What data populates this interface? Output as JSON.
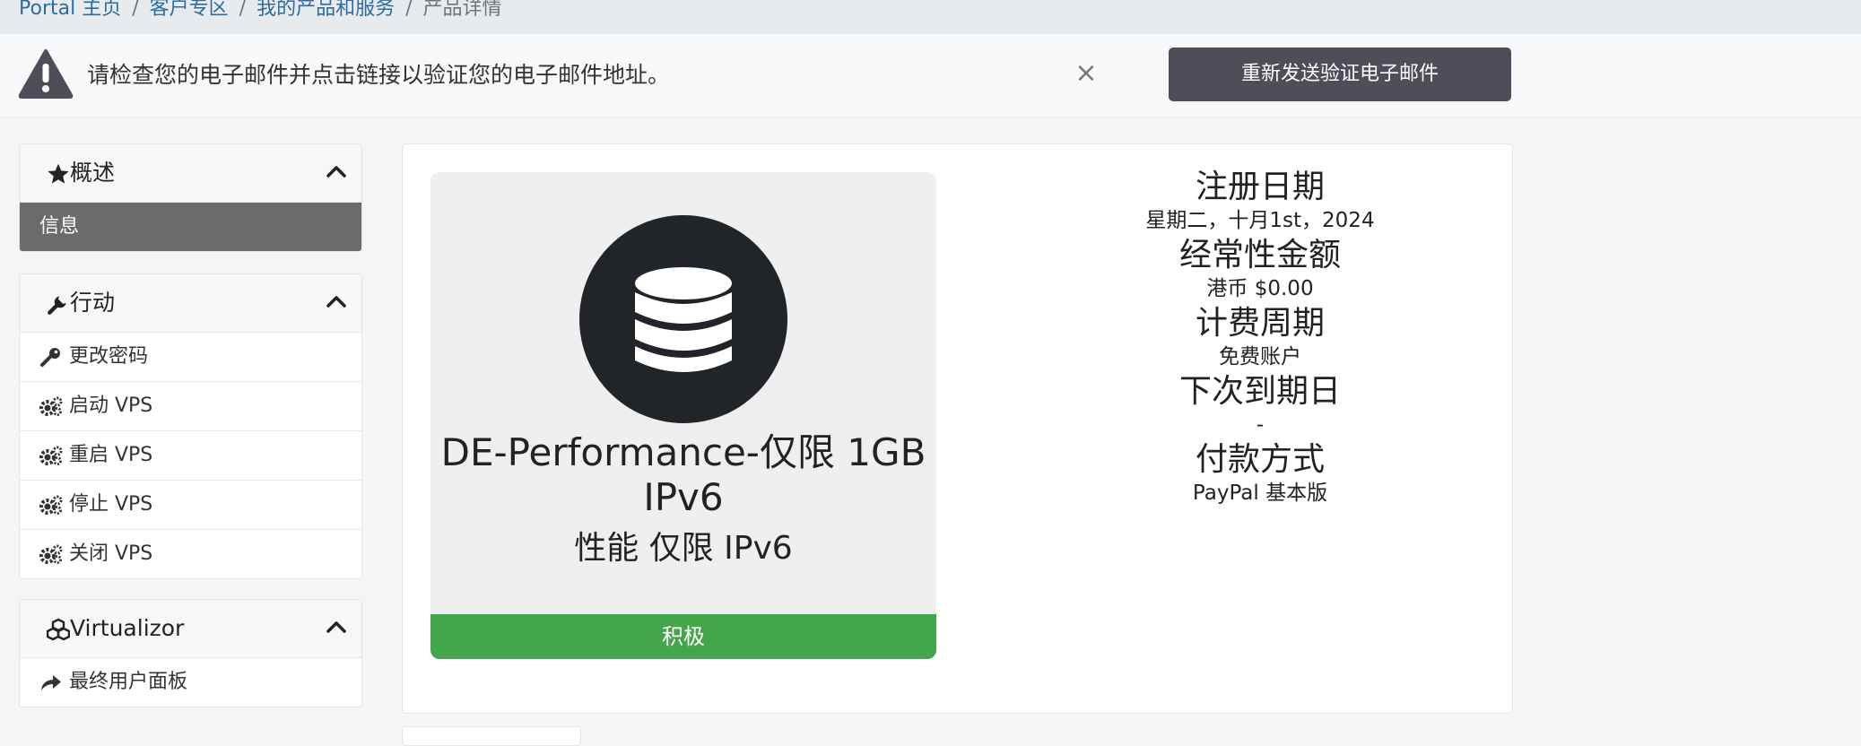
{
  "breadcrumb": {
    "items": [
      "Portal 主页",
      "客户专区",
      "我的产品和服务"
    ],
    "separator": "/",
    "current": "产品详情"
  },
  "alert": {
    "message": "请检查您的电子邮件并点击链接以验证您的电子邮件地址。",
    "close": "×",
    "button": "重新发送验证电子邮件"
  },
  "sidebar": {
    "overview": {
      "title": "概述",
      "items": [
        "信息"
      ]
    },
    "actions": {
      "title": "行动",
      "items": [
        "更改密码",
        "启动 VPS",
        "重启 VPS",
        "停止 VPS",
        "关闭 VPS"
      ]
    },
    "virtualizor": {
      "title": "Virtualizor",
      "items": [
        "最终用户面板"
      ]
    }
  },
  "product": {
    "name": "DE-Performance-仅限 1GB IPv6",
    "group": "性能 仅限 IPv6",
    "status": "积极",
    "status_color": "#44a64a",
    "icon": "database-icon"
  },
  "details": [
    {
      "label": "注册日期",
      "value": "星期二，十月1st，2024"
    },
    {
      "label": "经常性金额",
      "value": "港币 $0.00"
    },
    {
      "label": "计费周期",
      "value": "免费账户"
    },
    {
      "label": "下次到期日",
      "value": "-"
    },
    {
      "label": "付款方式",
      "value": "PayPal 基本版"
    }
  ]
}
